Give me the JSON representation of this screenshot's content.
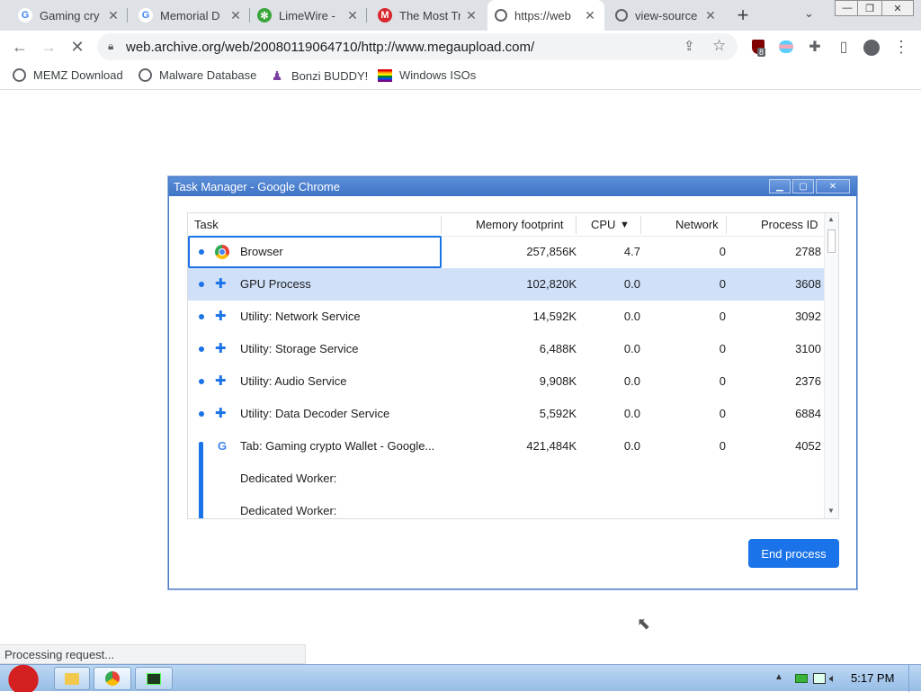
{
  "tabs": [
    {
      "title": "Gaming cry",
      "favicon": "google-g-icon",
      "active": false
    },
    {
      "title": "Memorial D",
      "favicon": "google-g-icon",
      "active": false
    },
    {
      "title": "LimeWire -",
      "favicon": "limewire-icon",
      "active": false
    },
    {
      "title": "The Most Tr",
      "favicon": "mega-icon",
      "active": false
    },
    {
      "title": "https://web",
      "favicon": "globe-icon",
      "active": true
    },
    {
      "title": "view-source",
      "favicon": "globe-icon",
      "active": false
    }
  ],
  "toolbar": {
    "url": "web.archive.org/web/20080119064710/http://www.megaupload.com/",
    "extension_badge": "8"
  },
  "bookmarks": [
    {
      "label": "MEMZ Download",
      "icon": "globe-icon"
    },
    {
      "label": "Malware Database",
      "icon": "globe-icon"
    },
    {
      "label": "Bonzi BUDDY!",
      "icon": "bonzi-icon"
    },
    {
      "label": "Windows ISOs",
      "icon": "windows-flag-icon"
    }
  ],
  "task_manager": {
    "title": "Task Manager - Google Chrome",
    "columns": [
      "Task",
      "Memory footprint",
      "CPU",
      "Network",
      "Process ID"
    ],
    "sort_indicator": "▼",
    "rows": [
      {
        "task": "Browser",
        "icon": "chrome-icon",
        "dot": true,
        "memory": "257,856K",
        "cpu": "4.7",
        "network": "0",
        "pid": "2788",
        "selected": false,
        "focused": true
      },
      {
        "task": "GPU Process",
        "icon": "puzzle-icon",
        "dot": true,
        "memory": "102,820K",
        "cpu": "0.0",
        "network": "0",
        "pid": "3608",
        "selected": true,
        "focused": false
      },
      {
        "task": "Utility: Network Service",
        "icon": "puzzle-icon",
        "dot": true,
        "memory": "14,592K",
        "cpu": "0.0",
        "network": "0",
        "pid": "3092",
        "selected": false,
        "focused": false
      },
      {
        "task": "Utility: Storage Service",
        "icon": "puzzle-icon",
        "dot": true,
        "memory": "6,488K",
        "cpu": "0.0",
        "network": "0",
        "pid": "3100",
        "selected": false,
        "focused": false
      },
      {
        "task": "Utility: Audio Service",
        "icon": "puzzle-icon",
        "dot": true,
        "memory": "9,908K",
        "cpu": "0.0",
        "network": "0",
        "pid": "2376",
        "selected": false,
        "focused": false
      },
      {
        "task": "Utility: Data Decoder Service",
        "icon": "puzzle-icon",
        "dot": true,
        "memory": "5,592K",
        "cpu": "0.0",
        "network": "0",
        "pid": "6884",
        "selected": false,
        "focused": false
      },
      {
        "task": "Tab: Gaming crypto Wallet - Google...",
        "icon": "google-g-icon",
        "dot": false,
        "memory": "421,484K",
        "cpu": "0.0",
        "network": "0",
        "pid": "4052",
        "selected": false,
        "focused": false
      },
      {
        "task": "Dedicated Worker:",
        "icon": "",
        "dot": false,
        "memory": "",
        "cpu": "",
        "network": "",
        "pid": "",
        "selected": false,
        "focused": false
      },
      {
        "task": "Dedicated Worker:",
        "icon": "",
        "dot": false,
        "memory": "",
        "cpu": "",
        "network": "",
        "pid": "",
        "selected": false,
        "focused": false
      }
    ],
    "end_button": "End process"
  },
  "status_bar": "Processing request...",
  "taskbar": {
    "clock": "5:17 PM"
  },
  "colors": {
    "accent": "#1a73e8",
    "selected_row": "#cfe0f8",
    "title_bar": "#3f74c6"
  }
}
